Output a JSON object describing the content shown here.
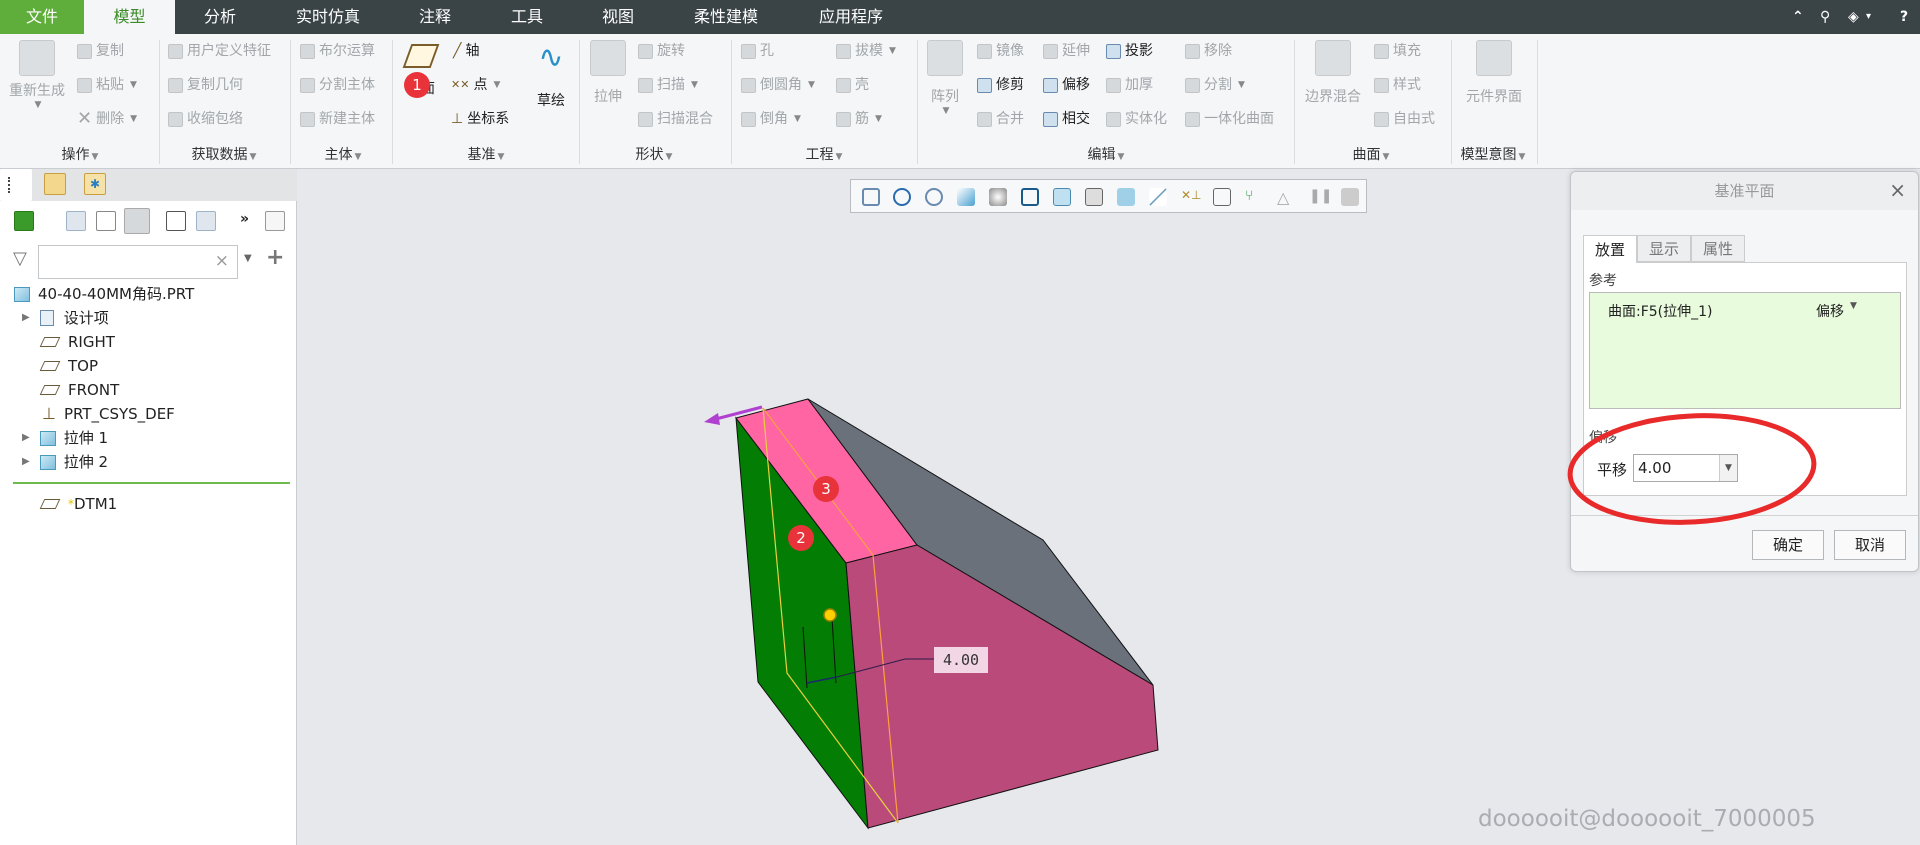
{
  "menubar": {
    "tabs": [
      "文件",
      "模型",
      "分析",
      "实时仿真",
      "注释",
      "工具",
      "视图",
      "柔性建模",
      "应用程序"
    ],
    "active_tab": "模型",
    "right_icons": [
      "collapse-ribbon-icon",
      "search-icon",
      "settings-icon",
      "help-icon"
    ],
    "right_glyphs": {
      "up": "⌃",
      "search": "⚲",
      "settings": "◈",
      "dropdown": "▾",
      "help": "?"
    }
  },
  "ribbon": {
    "operations": {
      "regenerate": "重新生成",
      "copy": "复制",
      "paste": "粘贴",
      "delete": "删除",
      "label": "操作"
    },
    "get_data": {
      "udf": "用户定义特征",
      "copy_geom": "复制几何",
      "shrinkwrap": "收缩包络",
      "label": "获取数据"
    },
    "body": {
      "boolean": "布尔运算",
      "split_body": "分割主体",
      "new_body": "新建主体",
      "label": "主体"
    },
    "datum": {
      "plane": "平面",
      "axis": "轴",
      "point": "点",
      "csys": "坐标系",
      "sketch": "草绘",
      "label": "基准"
    },
    "shapes": {
      "extrude": "拉伸",
      "revolve": "旋转",
      "sweep": "扫描",
      "swept_blend": "扫描混合",
      "label": "形状"
    },
    "engineering": {
      "hole": "孔",
      "round": "倒圆角",
      "chamfer": "倒角",
      "draft": "拔模",
      "shell": "壳",
      "rib": "筋",
      "label": "工程"
    },
    "editing": {
      "pattern": "阵列",
      "mirror": "镜像",
      "trim": "修剪",
      "merge": "合并",
      "extend": "延伸",
      "offset": "偏移",
      "intersect": "相交",
      "project": "投影",
      "thicken": "加厚",
      "solidify": "实体化",
      "remove": "移除",
      "split": "分割",
      "unify": "一体化曲面",
      "label": "编辑"
    },
    "surfaces": {
      "boundary_blend": "边界混合",
      "fill": "填充",
      "style": "样式",
      "freestyle": "自由式",
      "label": "曲面"
    },
    "model_intent": {
      "component_interface": "元件界面",
      "label": "模型意图"
    },
    "dropdown_glyph": "▼"
  },
  "model_tree": {
    "filter_placeholder": "",
    "clear_glyph": "×",
    "add_glyph": "+",
    "more_glyph": "»",
    "root": "40-40-40MM角码.PRT",
    "items": [
      {
        "label": "设计项",
        "expandable": true
      },
      {
        "label": "RIGHT"
      },
      {
        "label": "TOP"
      },
      {
        "label": "FRONT"
      },
      {
        "label": "PRT_CSYS_DEF"
      },
      {
        "label": "拉伸 1",
        "expandable": true
      },
      {
        "label": "拉伸 2",
        "expandable": true
      }
    ],
    "new_feature": {
      "marker": "*",
      "label": "DTM1"
    }
  },
  "graphics": {
    "dimension_value": "4.00",
    "badges": [
      "1",
      "2",
      "3"
    ],
    "colors": {
      "green_face": "#037d03",
      "pink_face": "#ff65a3",
      "magenta_face": "#b94a7a",
      "gray_face": "#6a717b",
      "highlight": "#ffa040"
    },
    "watermark": "doooooit@doooooit_7000005"
  },
  "dialog": {
    "title": "基准平面",
    "close_glyph": "×",
    "tabs": [
      "放置",
      "显示",
      "属性"
    ],
    "active_tab": "放置",
    "references_label": "参考",
    "reference": {
      "name": "曲面:F5(拉伸_1)",
      "constraint": "偏移"
    },
    "offset_label": "偏移",
    "translate_label": "平移",
    "translate_value": "4.00",
    "ok": "确定",
    "cancel": "取消"
  }
}
